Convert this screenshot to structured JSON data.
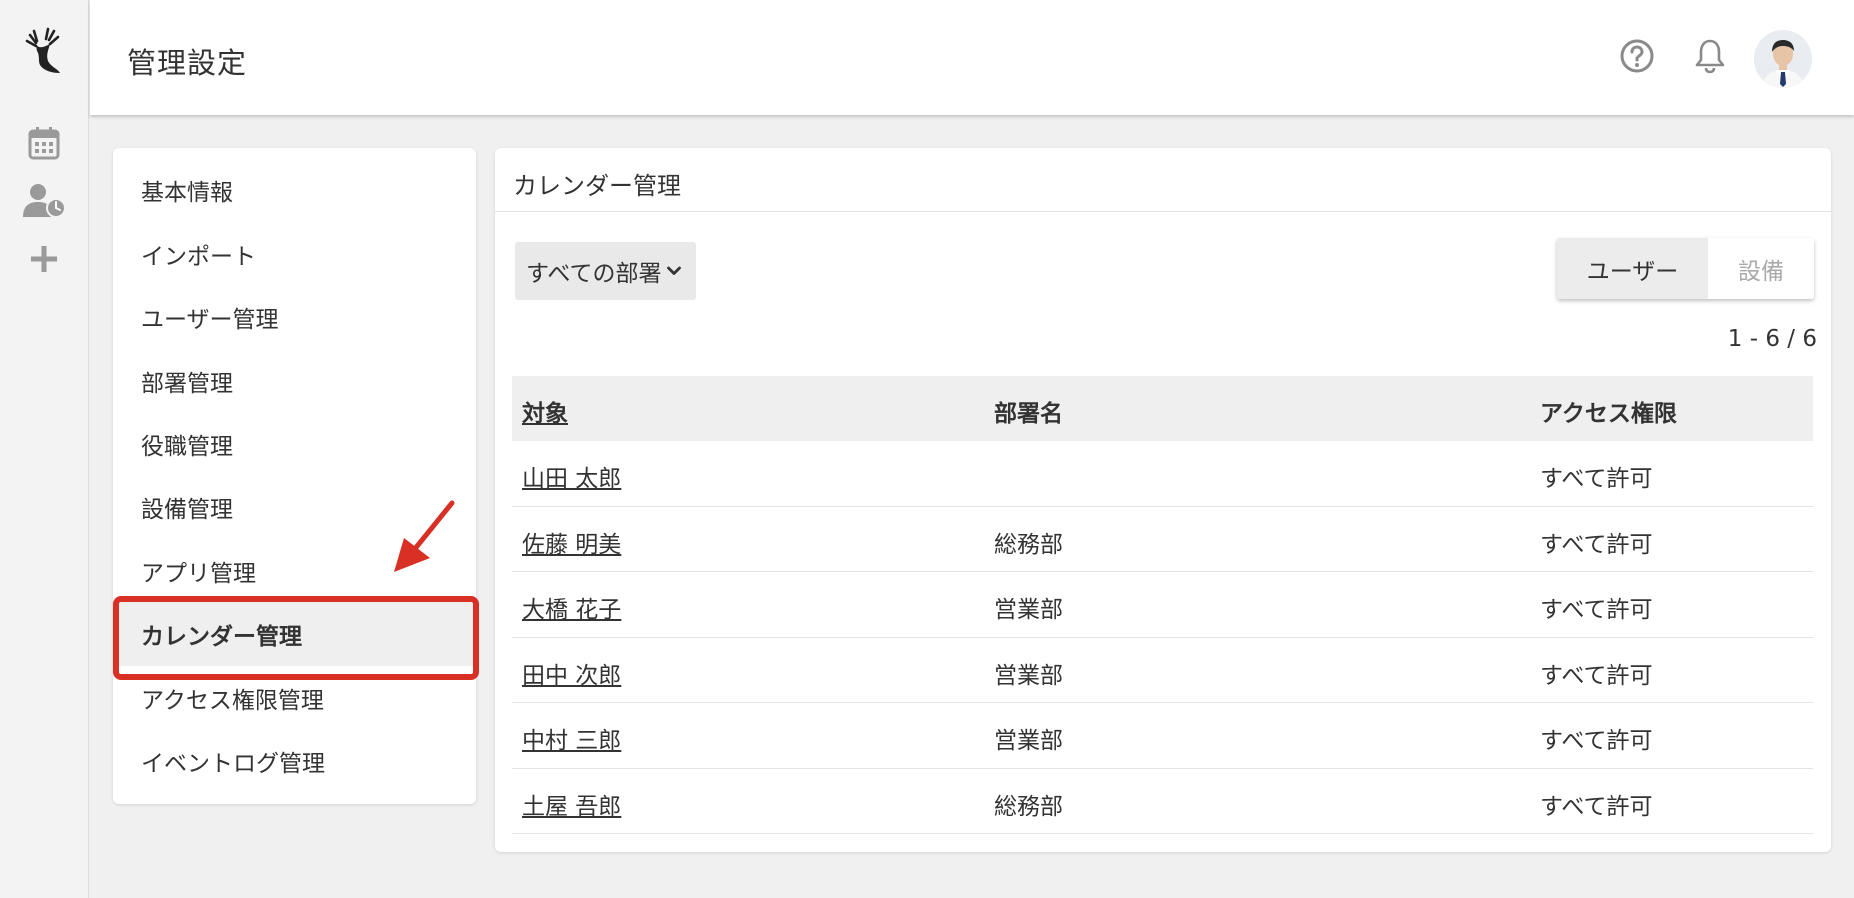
{
  "header": {
    "title": "管理設定"
  },
  "rail": {
    "icons": [
      "deer-logo-icon",
      "calendar-icon",
      "user-clock-icon",
      "plus-icon"
    ]
  },
  "menu": {
    "items": [
      {
        "label": "基本情報",
        "active": false
      },
      {
        "label": "インポート",
        "active": false
      },
      {
        "label": "ユーザー管理",
        "active": false
      },
      {
        "label": "部署管理",
        "active": false
      },
      {
        "label": "役職管理",
        "active": false
      },
      {
        "label": "設備管理",
        "active": false
      },
      {
        "label": "アプリ管理",
        "active": false
      },
      {
        "label": "カレンダー管理",
        "active": true
      },
      {
        "label": "アクセス権限管理",
        "active": false
      },
      {
        "label": "イベントログ管理",
        "active": false
      }
    ]
  },
  "main": {
    "title": "カレンダー管理",
    "department_filter": "すべての部署",
    "toggle": {
      "user_label": "ユーザー",
      "equipment_label": "設備",
      "selected": "user"
    },
    "pagination": "1 - 6 / 6",
    "table": {
      "columns": [
        "対象",
        "部署名",
        "アクセス権限"
      ],
      "rows": [
        {
          "name": "山田 太郎",
          "department": "",
          "access": "すべて許可"
        },
        {
          "name": "佐藤 明美",
          "department": "総務部",
          "access": "すべて許可"
        },
        {
          "name": "大橋 花子",
          "department": "営業部",
          "access": "すべて許可"
        },
        {
          "name": "田中 次郎",
          "department": "営業部",
          "access": "すべて許可"
        },
        {
          "name": "中村 三郎",
          "department": "営業部",
          "access": "すべて許可"
        },
        {
          "name": "土屋 吾郎",
          "department": "総務部",
          "access": "すべて許可"
        }
      ]
    }
  },
  "colors": {
    "highlight": "#d93025",
    "background": "#f0f0f0",
    "icon_gray": "#9a9a9a"
  }
}
